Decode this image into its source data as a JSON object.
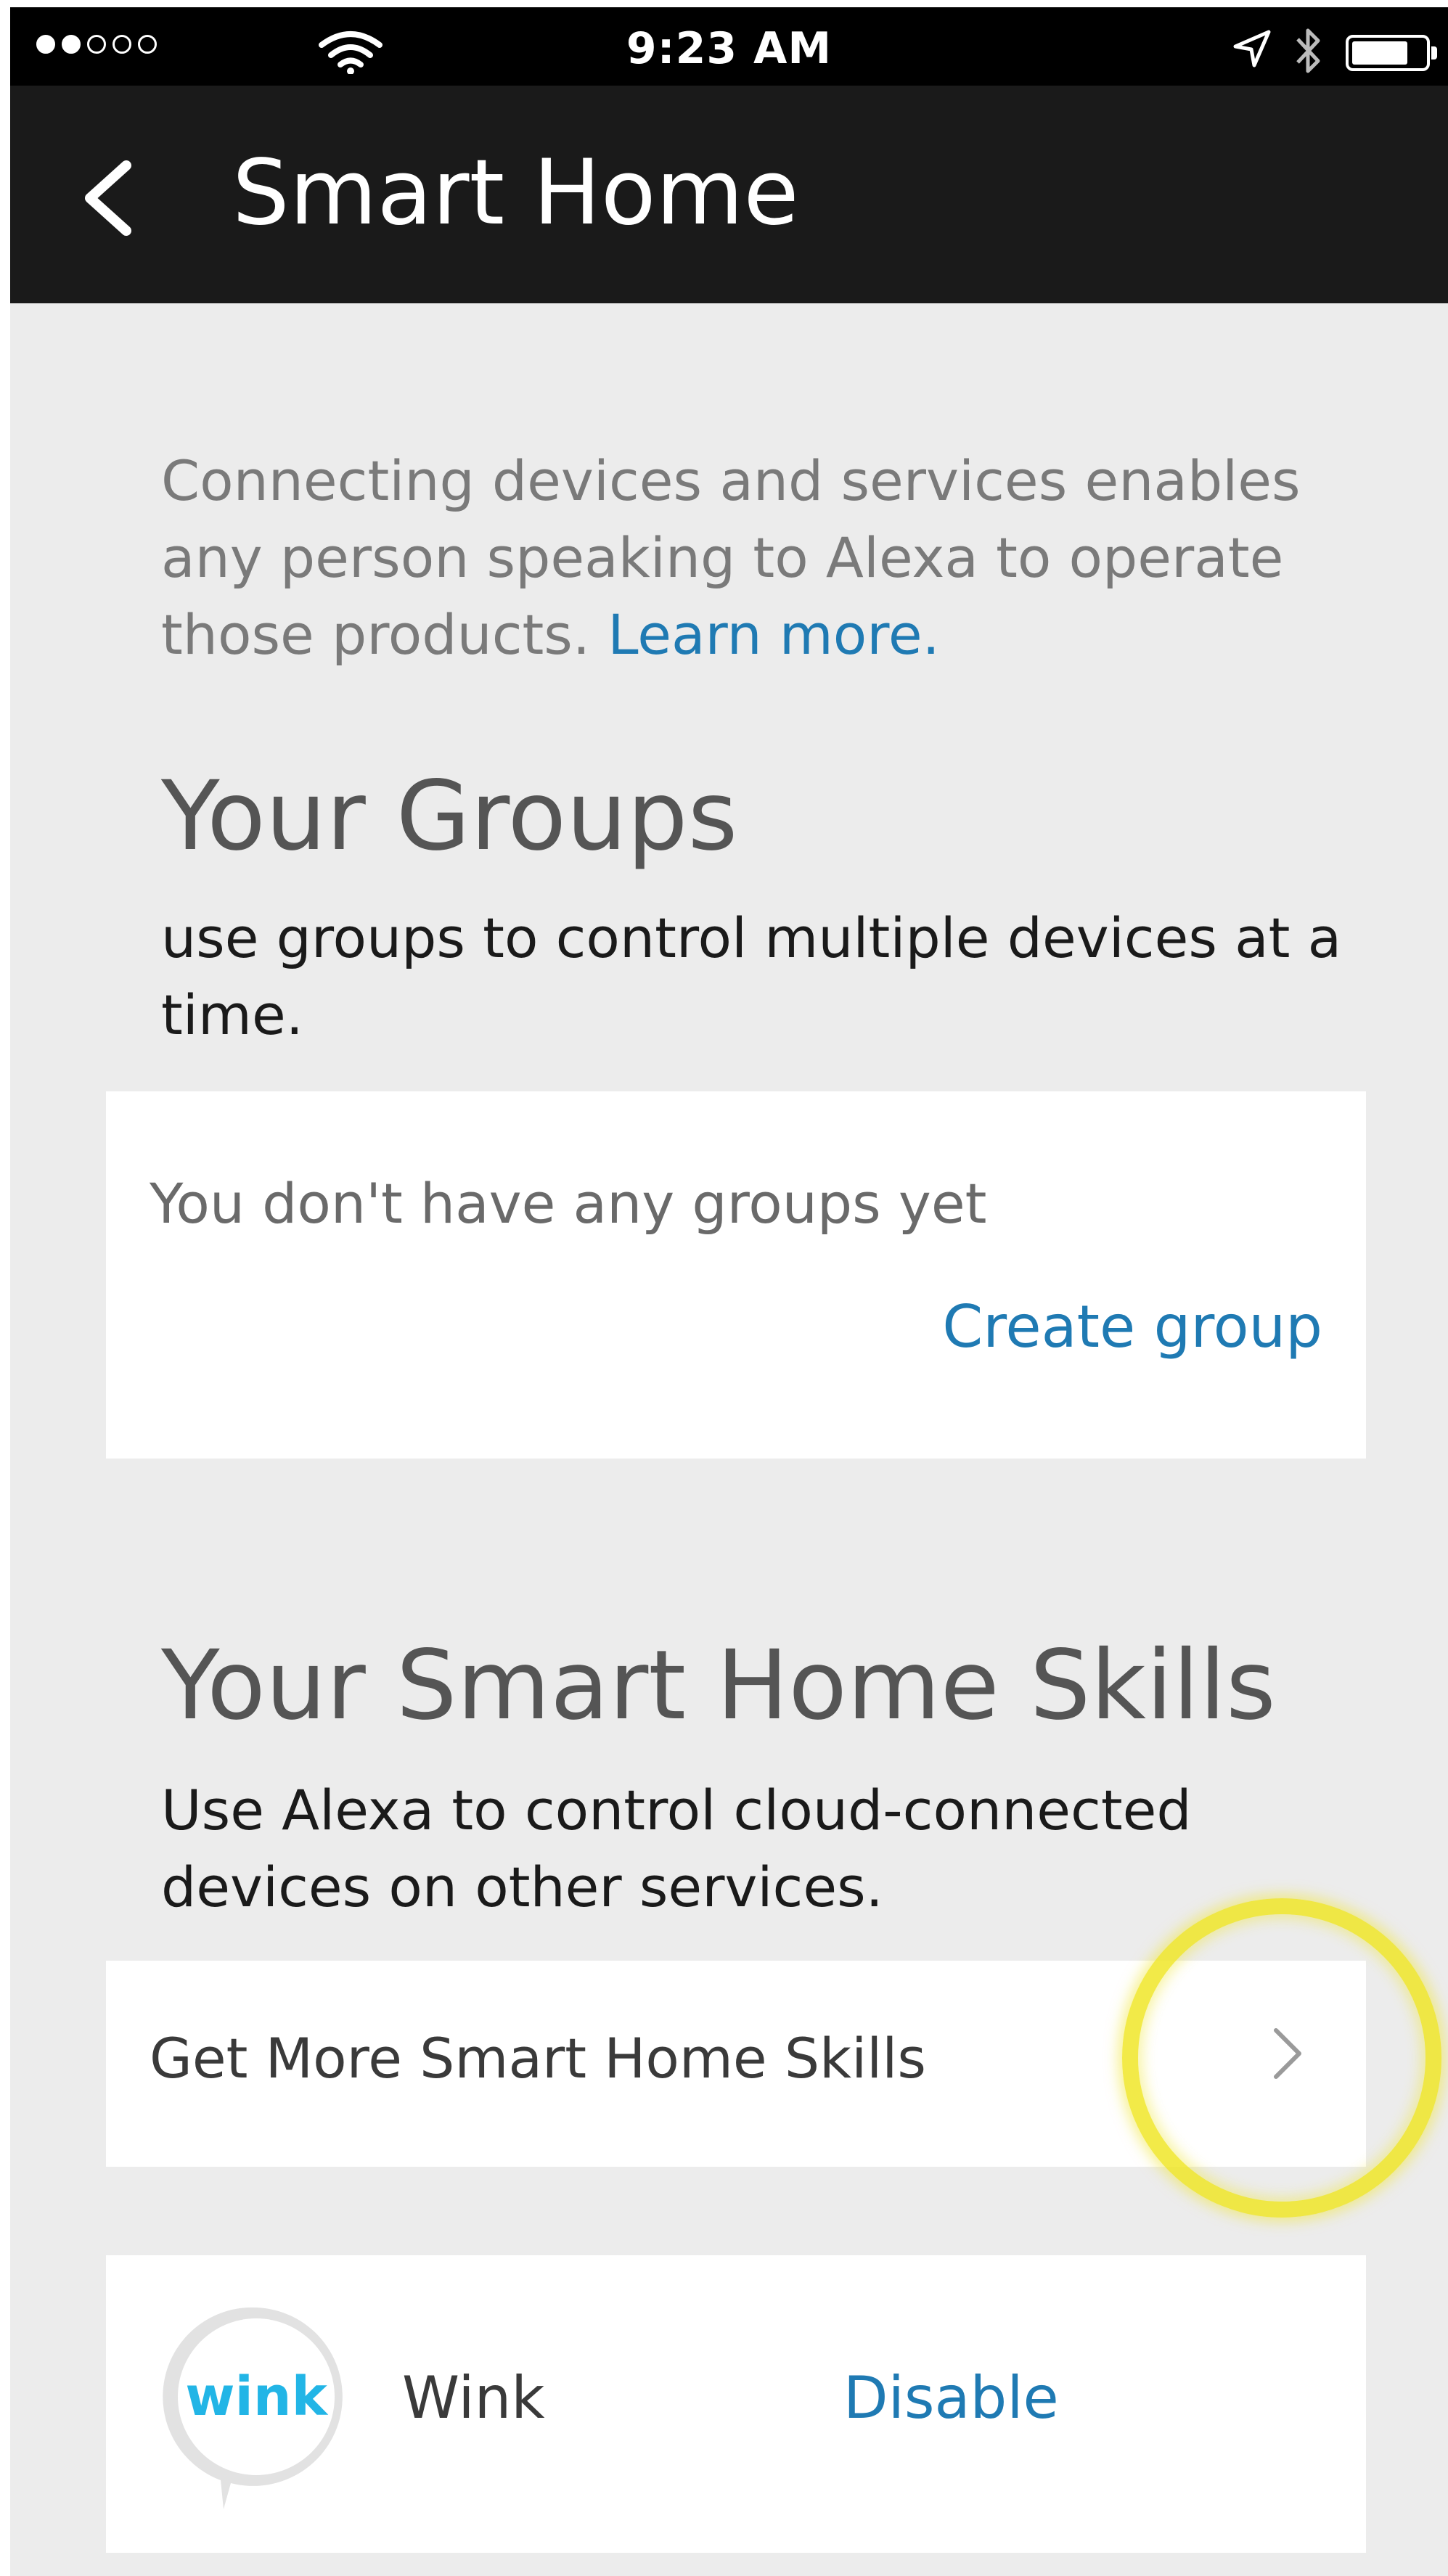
{
  "status_bar": {
    "time": "9:23 AM",
    "signal_strength": 2,
    "signal_max": 5,
    "battery_level_percent": 70,
    "icons": [
      "signal-dots-icon",
      "wifi-icon",
      "location-arrow-icon",
      "bluetooth-icon",
      "battery-icon"
    ]
  },
  "nav": {
    "title": "Smart Home",
    "back_icon": "chevron-left-icon"
  },
  "intro": {
    "text": "Connecting devices and services enables any person speaking to Alexa to operate those products. ",
    "link_text": "Learn more."
  },
  "groups": {
    "title": "Your Groups",
    "description": "use groups to control multiple devices at a time.",
    "empty_text": "You don't have any groups yet",
    "create_label": "Create group"
  },
  "skills": {
    "title": "Your Smart Home Skills",
    "description": "Use Alexa to control cloud-connected devices on other services.",
    "get_more_label": "Get More Smart Home Skills",
    "items": [
      {
        "name": "Wink",
        "logo_text": "wink",
        "action_label": "Disable"
      }
    ]
  },
  "colors": {
    "status_bar": "#000000",
    "nav_bar": "#1a1a1a",
    "background": "#ececec",
    "card": "#ffffff",
    "link": "#1f7ab3",
    "wink_brand": "#22b5e6",
    "highlight": "#f0e628"
  }
}
